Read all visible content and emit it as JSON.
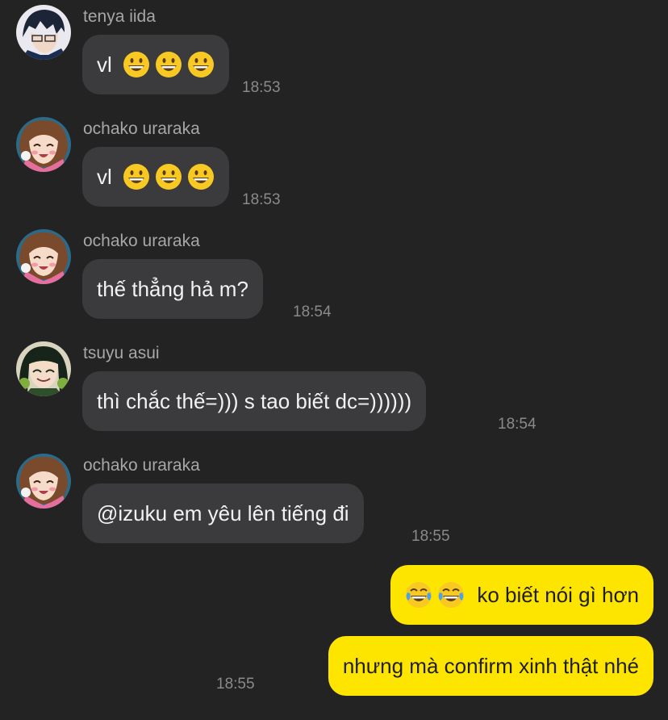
{
  "messages": [
    {
      "sender": "tenya iida",
      "text": "vl",
      "emojis": [
        "grinning-face",
        "grinning-face",
        "grinning-face"
      ],
      "time": "18:53",
      "avatar": "tenya-avatar"
    },
    {
      "sender": "ochako uraraka",
      "text": "vl",
      "emojis": [
        "grinning-face",
        "grinning-face",
        "grinning-face"
      ],
      "time": "18:53",
      "avatar": "ochako-avatar"
    },
    {
      "sender": "ochako uraraka",
      "text": "thế thẳng hả m?",
      "time": "18:54",
      "avatar": "ochako-avatar"
    },
    {
      "sender": "tsuyu asui",
      "text": "thì chắc thế=))) s tao biết dc=))))))",
      "time": "18:54",
      "avatar": "tsuyu-avatar"
    },
    {
      "sender": "ochako uraraka",
      "text": "@izuku em yêu lên tiếng đi",
      "time": "18:55",
      "avatar": "ochako-avatar"
    }
  ],
  "own_messages": [
    {
      "text": "ko biết nói gì hơn",
      "emojis": [
        "tears-of-joy-face",
        "tears-of-joy-face"
      ]
    },
    {
      "text": "nhưng mà confirm xinh thật nhé",
      "time": "18:55"
    }
  ],
  "colors": {
    "background": "#232323",
    "incoming_bubble": "#3b3b3d",
    "outgoing_bubble": "#fee500"
  }
}
